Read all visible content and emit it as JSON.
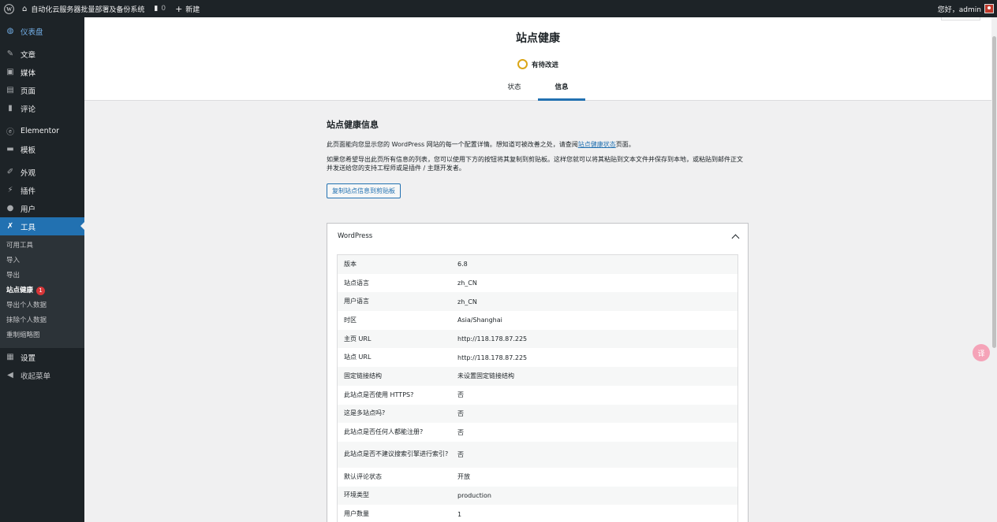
{
  "adminbar": {
    "site_name": "自动化云服务器批量部署及备份系统",
    "comments_count": "0",
    "new_label": "新建",
    "greeting": "您好，admin"
  },
  "sidebar": {
    "items": [
      {
        "label": "仪表盘",
        "icon": "dashboard-icon"
      },
      {
        "label": "文章",
        "icon": "pin-icon"
      },
      {
        "label": "媒体",
        "icon": "media-icon"
      },
      {
        "label": "页面",
        "icon": "page-icon"
      },
      {
        "label": "评论",
        "icon": "comment-icon"
      },
      {
        "label": "Elementor",
        "icon": "elementor-icon"
      },
      {
        "label": "模板",
        "icon": "folder-icon"
      },
      {
        "label": "外观",
        "icon": "brush-icon"
      },
      {
        "label": "插件",
        "icon": "plugin-icon"
      },
      {
        "label": "用户",
        "icon": "user-icon"
      },
      {
        "label": "工具",
        "icon": "wrench-icon"
      },
      {
        "label": "设置",
        "icon": "settings-icon"
      },
      {
        "label": "收起菜单",
        "icon": "collapse-icon"
      }
    ],
    "submenu": [
      "可用工具",
      "导入",
      "导出",
      "站点健康",
      "导出个人数据",
      "抹除个人数据",
      "重制缩略图"
    ],
    "badge": "1"
  },
  "header": {
    "title": "站点健康",
    "status": "有待改进",
    "tabs": [
      "状态",
      "信息"
    ]
  },
  "main": {
    "heading": "站点健康信息",
    "p1_before": "此页面能向您显示您的 WordPress 网站的每一个配置详情。想知道可被改善之处，请查阅",
    "p1_link": "站点健康状态",
    "p1_after": "页面。",
    "p2": "如果您希望导出此页所有信息的列表，您可以使用下方的按钮将其复制到剪贴板。这样您就可以将其粘贴到文本文件并保存到本地，或粘贴到邮件正文并发送给您的支持工程师或是插件 / 主题开发者。",
    "copy_button": "复制站点信息到剪贴板",
    "panel_title": "WordPress",
    "rows": [
      {
        "k": "版本",
        "v": "6.8"
      },
      {
        "k": "站点语言",
        "v": "zh_CN"
      },
      {
        "k": "用户语言",
        "v": "zh_CN"
      },
      {
        "k": "时区",
        "v": "Asia/Shanghai"
      },
      {
        "k": "主页 URL",
        "v": "http://118.178.87.225"
      },
      {
        "k": "站点 URL",
        "v": "http://118.178.87.225"
      },
      {
        "k": "固定链接结构",
        "v": "未设置固定链接结构"
      },
      {
        "k": "此站点是否使用 HTTPS?",
        "v": "否"
      },
      {
        "k": "这是多站点吗?",
        "v": "否"
      },
      {
        "k": "此站点是否任何人都能注册?",
        "v": "否"
      },
      {
        "k": "此站点是否不建议搜索引擎进行索引?",
        "v": "否"
      },
      {
        "k": "默认评论状态",
        "v": "开放"
      },
      {
        "k": "环境类型",
        "v": "production"
      },
      {
        "k": "用户数量",
        "v": "1"
      }
    ]
  },
  "floating": {
    "label": "译"
  }
}
